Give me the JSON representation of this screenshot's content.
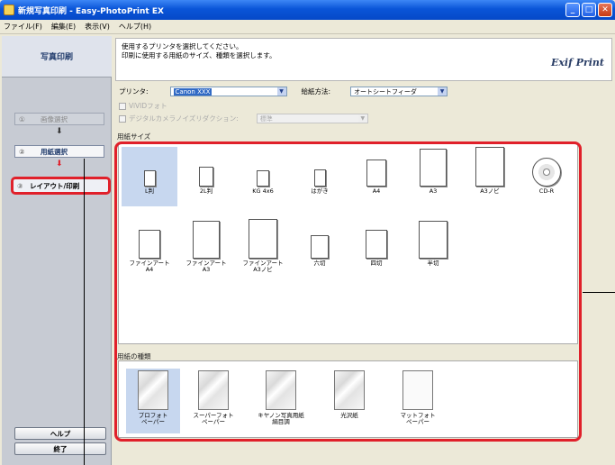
{
  "window": {
    "title": "新規写真印刷 - Easy-PhotoPrint EX"
  },
  "menu": [
    "ファイル(F)",
    "編集(E)",
    "表示(V)",
    "ヘルプ(H)"
  ],
  "sidebar": {
    "title": "写真印刷",
    "steps": [
      {
        "num": "①",
        "label": "画像選択"
      },
      {
        "num": "②",
        "label": "用紙選択"
      },
      {
        "num": "③",
        "label": "レイアウト/印刷"
      }
    ],
    "help_label": "ヘルプ",
    "exit_label": "終了"
  },
  "instructions": {
    "line1": "使用するプリンタを選択してください。",
    "line2": "印刷に使用する用紙のサイズ、種類を選択します。",
    "logo": "Exif Print"
  },
  "settings": {
    "printer_label": "プリンタ:",
    "printer_value": "Canon XXX",
    "feed_label": "給紙方法:",
    "feed_value": "オートシートフィーダ",
    "vivid_label": "ViVIDフォト",
    "noise_label": "デジタルカメラノイズリダクション:",
    "noise_value": "標準"
  },
  "paper_size": {
    "label": "用紙サイズ",
    "items": [
      {
        "label": "L判",
        "selected": true
      },
      {
        "label": "2L判"
      },
      {
        "label": "KG 4x6"
      },
      {
        "label": "はがき"
      },
      {
        "label": "A4"
      },
      {
        "label": "A3"
      },
      {
        "label": "A3ノビ"
      },
      {
        "label": "CD-R"
      },
      {
        "label": "ファインアート\nA4"
      },
      {
        "label": "ファインアート\nA3"
      },
      {
        "label": "ファインアート\nA3ノビ"
      },
      {
        "label": "六切"
      },
      {
        "label": "四切"
      },
      {
        "label": "半切"
      }
    ]
  },
  "paper_type": {
    "label": "用紙の種類",
    "items": [
      {
        "label": "プロフォト\nペーパー",
        "selected": true
      },
      {
        "label": "スーパーフォト\nペーパー"
      },
      {
        "label": "キヤノン写真用紙\n絹目調"
      },
      {
        "label": "光沢紙"
      },
      {
        "label": "マットフォト\nペーパー"
      }
    ]
  },
  "colors": {
    "highlight_frame": "#e0202a",
    "selection": "#c7d7ef",
    "titlebar": "#0a55d8"
  }
}
